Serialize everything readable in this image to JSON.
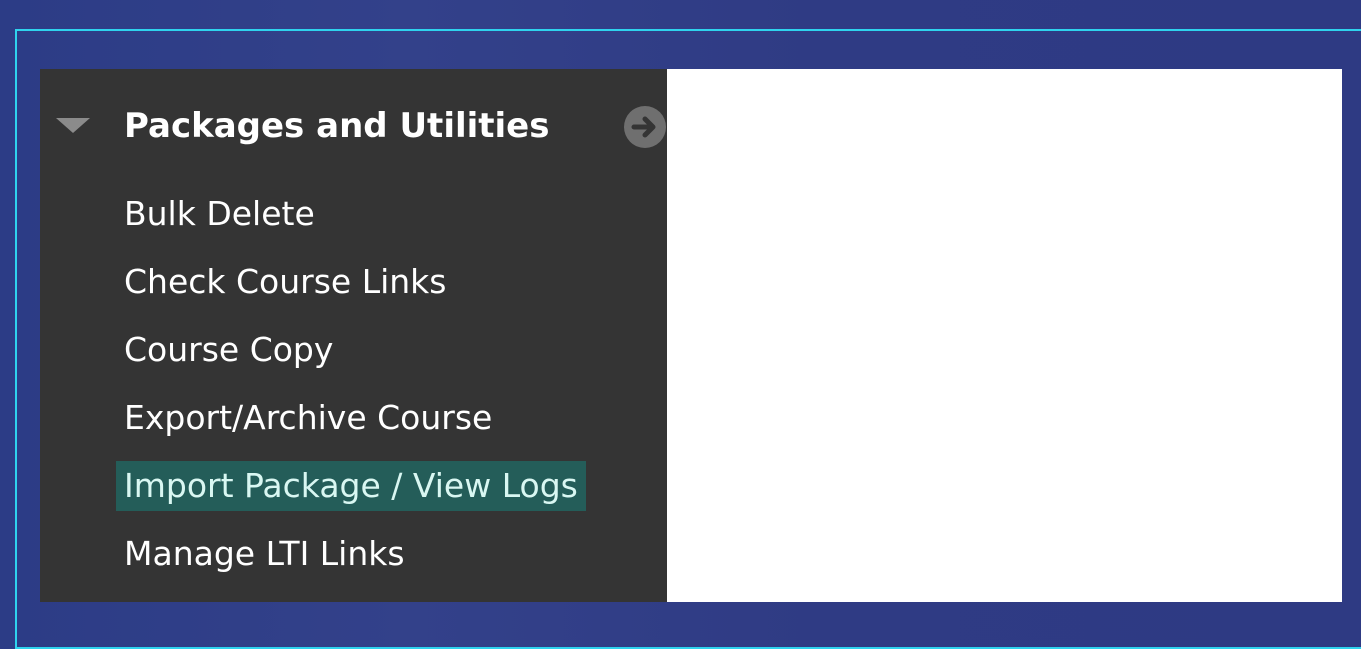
{
  "section": {
    "title": "Packages and Utilities",
    "collapse_icon": "triangle-down-icon",
    "go_icon": "arrow-right-circle-icon"
  },
  "menu": {
    "items": [
      {
        "label": "Bulk Delete"
      },
      {
        "label": "Check Course Links"
      },
      {
        "label": "Course Copy"
      },
      {
        "label": "Export/Archive Course"
      },
      {
        "label": "Import Package / View Logs",
        "selected": true
      },
      {
        "label": "Manage LTI Links"
      }
    ]
  },
  "colors": {
    "background": "#2f3c85",
    "outline": "#2fd3ee",
    "panel": "#343434",
    "selected_highlight": "#245d59",
    "content": "#ffffff"
  }
}
